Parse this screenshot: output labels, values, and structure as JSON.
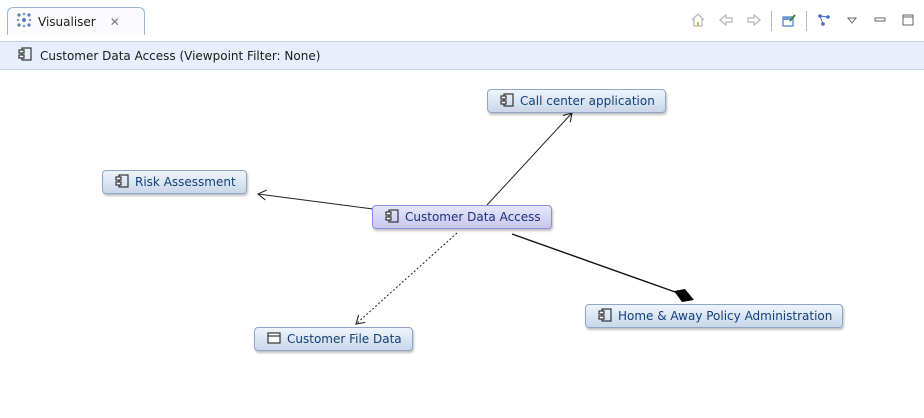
{
  "tab": {
    "title": "Visualiser",
    "close_glyph": "✕"
  },
  "toolbar": {
    "items": [
      {
        "icon": "home-icon"
      },
      {
        "icon": "back-arrow-icon"
      },
      {
        "icon": "forward-arrow-icon"
      },
      {
        "icon": "pin-icon"
      },
      {
        "icon": "layout-icon"
      },
      {
        "icon": "view-menu-icon"
      },
      {
        "icon": "minimize-icon"
      },
      {
        "icon": "maximize-icon"
      }
    ]
  },
  "header": {
    "title": "Customer Data  Access (Viewpoint Filter: None)"
  },
  "nodes": {
    "call_center": {
      "label": "Call center application",
      "icon": "component-icon"
    },
    "risk_assessment": {
      "label": "Risk Assessment",
      "icon": "component-icon"
    },
    "customer_data_access": {
      "label": "Customer Data  Access",
      "icon": "component-icon"
    },
    "customer_file_data": {
      "label": "Customer File Data",
      "icon": "data-object-icon"
    },
    "home_away": {
      "label": "Home & Away Policy Administration",
      "icon": "component-icon"
    }
  }
}
